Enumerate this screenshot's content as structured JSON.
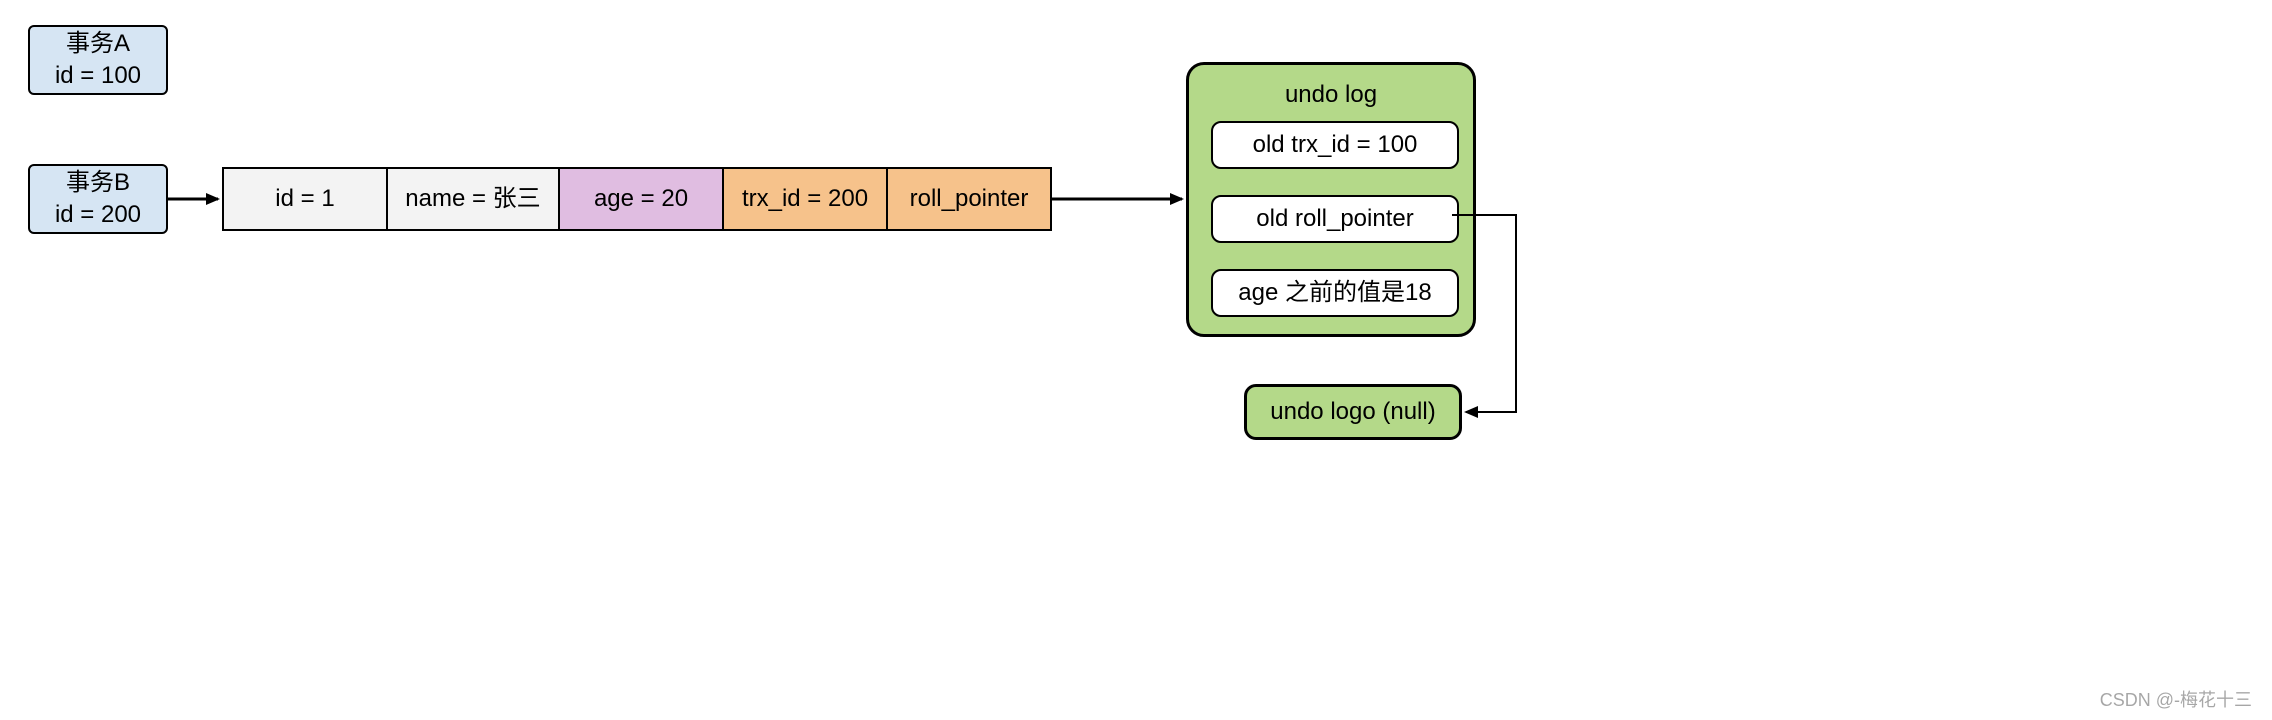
{
  "transactions": {
    "a": {
      "label": "事务A\nid = 100"
    },
    "b": {
      "label": "事务B\nid = 200"
    }
  },
  "row": {
    "id": "id = 1",
    "name": "name = 张三",
    "age": "age = 20",
    "trx": "trx_id = 200",
    "roll": "roll_pointer"
  },
  "undo_log": {
    "title": "undo log",
    "items": {
      "old_trx": "old trx_id = 100",
      "old_roll": "old roll_pointer",
      "old_age": "age 之前的值是18"
    },
    "null_label": "undo logo (null)"
  },
  "watermark": "CSDN @-梅花十三"
}
